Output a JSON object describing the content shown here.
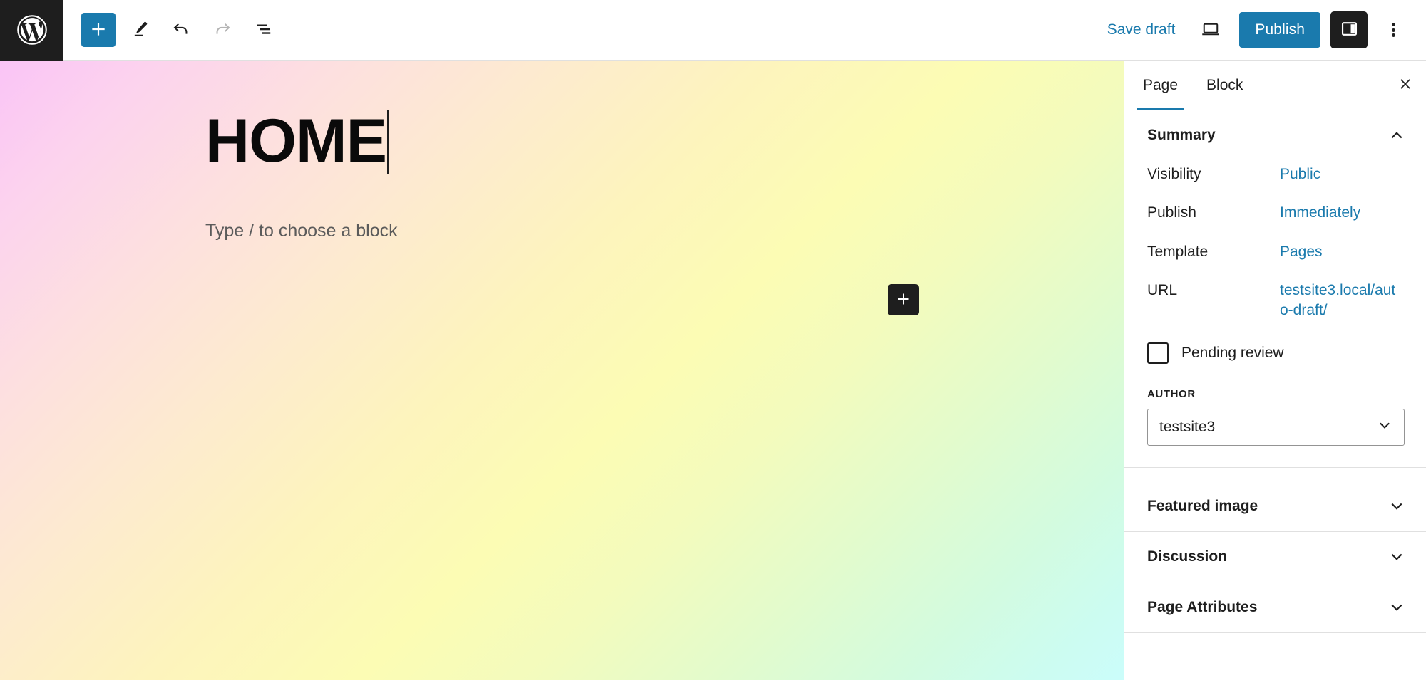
{
  "header": {
    "logo_icon": "wordpress-logo-icon",
    "toolbar": [
      {
        "name": "add-block-button",
        "icon": "plus-icon",
        "label": "Add block",
        "variant": "primary"
      },
      {
        "name": "tools-edit-button",
        "icon": "pencil-icon",
        "label": "Tools",
        "variant": "default"
      },
      {
        "name": "undo-button",
        "icon": "undo-icon",
        "label": "Undo",
        "variant": "default"
      },
      {
        "name": "redo-button",
        "icon": "redo-icon",
        "label": "Redo",
        "variant": "disabled"
      },
      {
        "name": "document-overview-button",
        "icon": "document-overview-icon",
        "label": "Document Overview",
        "variant": "default"
      }
    ],
    "save_draft_label": "Save draft",
    "preview_label": "Preview",
    "publish_label": "Publish",
    "settings_toggle_label": "Settings",
    "options_label": "Options",
    "accent_color": "#1a7aad",
    "dark_color": "#1e1e1e"
  },
  "canvas": {
    "page_title": "HOME",
    "block_placeholder": "Type / to choose a block",
    "appender_label": "Add block",
    "gradient_stops": [
      "#fac4f6",
      "#fdf4bd",
      "#fcfcb4",
      "#d3fbdf",
      "#cbfdfb"
    ]
  },
  "sidebar": {
    "tabs": [
      {
        "label": "Page",
        "active": true
      },
      {
        "label": "Block",
        "active": false
      }
    ],
    "close_label": "Close Settings",
    "summary": {
      "title": "Summary",
      "expanded": true,
      "rows": [
        {
          "label": "Visibility",
          "value": "Public"
        },
        {
          "label": "Publish",
          "value": "Immediately"
        },
        {
          "label": "Template",
          "value": "Pages"
        },
        {
          "label": "URL",
          "value": "testsite3.local/auto-draft/"
        }
      ],
      "pending_review": {
        "label": "Pending review",
        "checked": false
      },
      "author": {
        "label": "AUTHOR",
        "value": "testsite3"
      }
    },
    "panels": [
      {
        "title": "Featured image",
        "expanded": false
      },
      {
        "title": "Discussion",
        "expanded": false
      },
      {
        "title": "Page Attributes",
        "expanded": false
      }
    ]
  }
}
